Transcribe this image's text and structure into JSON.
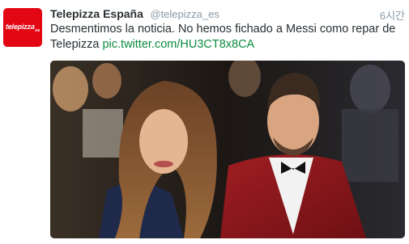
{
  "tweet": {
    "avatar": {
      "brand": "telepizza",
      "suffix": ".es",
      "color": "#e30613"
    },
    "fullname": "Telepizza España",
    "username": "@telepizza_es",
    "timestamp": "6시간",
    "text": "Desmentimos la noticia. No hemos fichado a Messi como repar de Telepizza ",
    "link": "pic.twitter.com/HU3CT8x8CA",
    "link_color": "#0a8c3c",
    "media": {
      "description_icon": "photo"
    }
  }
}
